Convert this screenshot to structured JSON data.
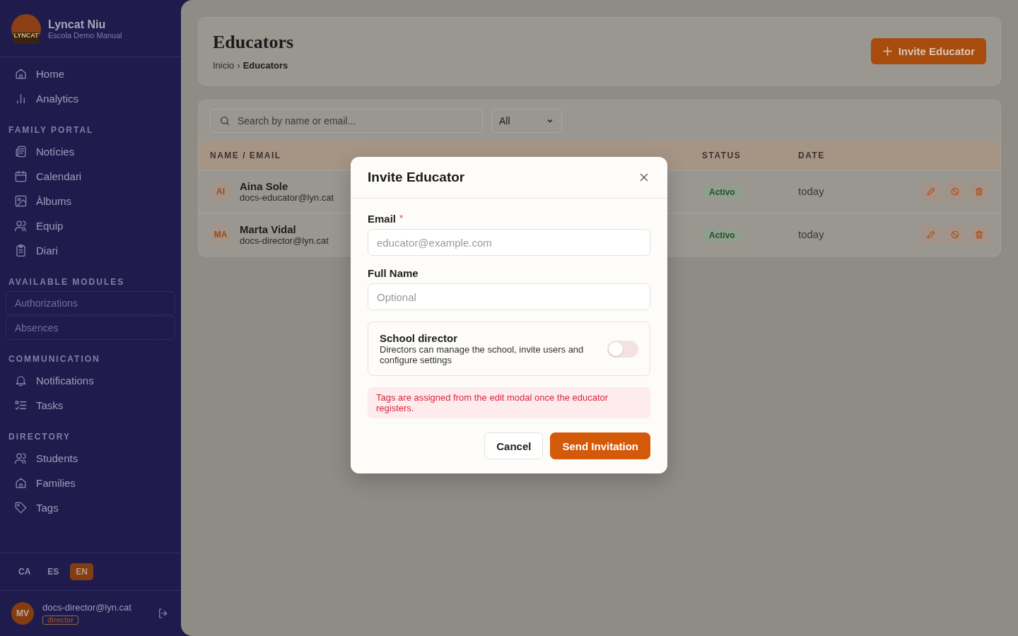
{
  "brand": {
    "name": "Lyncat Niu",
    "school": "Escola Demo Manual",
    "logo_text": "LYNCAT"
  },
  "sidebar": {
    "sections": [
      {
        "items": [
          {
            "label": "Home",
            "kind": "link"
          },
          {
            "label": "Analytics",
            "kind": "link"
          }
        ]
      },
      {
        "heading": "FAMILY PORTAL",
        "items": [
          {
            "label": "Notícies",
            "kind": "link"
          },
          {
            "label": "Calendari",
            "kind": "link"
          },
          {
            "label": "Àlbums",
            "kind": "link"
          },
          {
            "label": "Equip",
            "kind": "link"
          },
          {
            "label": "Diari",
            "kind": "link"
          }
        ]
      },
      {
        "heading": "AVAILABLE MODULES",
        "items": [
          {
            "label": "Authorizations",
            "kind": "module"
          },
          {
            "label": "Absences",
            "kind": "module"
          }
        ]
      },
      {
        "heading": "COMMUNICATION",
        "items": [
          {
            "label": "Notifications",
            "kind": "link"
          },
          {
            "label": "Tasks",
            "kind": "link"
          }
        ]
      },
      {
        "heading": "DIRECTORY",
        "items": [
          {
            "label": "Students",
            "kind": "link"
          },
          {
            "label": "Families",
            "kind": "link"
          },
          {
            "label": "Tags",
            "kind": "link"
          }
        ]
      }
    ],
    "languages": [
      {
        "label": "CA",
        "selected": false
      },
      {
        "label": "ES",
        "selected": false
      },
      {
        "label": "EN",
        "selected": true
      }
    ],
    "user": {
      "initials": "MV",
      "email": "docs-director@lyn.cat",
      "role": "director"
    }
  },
  "page": {
    "title": "Educators",
    "breadcrumb": [
      "Inicio",
      "›",
      "Educators"
    ],
    "invite_button": "Invite Educator"
  },
  "filters": {
    "search": {
      "placeholder": "Search by name or email..."
    },
    "status_select": "All"
  },
  "table": {
    "columns": [
      "NAME / EMAIL",
      "STATUS",
      "DATE"
    ],
    "rows": [
      {
        "initials": "AI",
        "name": "Aina Sole",
        "email": "docs-educator@lyn.cat",
        "status": "Activo",
        "date": "today"
      },
      {
        "initials": "MA",
        "name": "Marta Vidal",
        "email": "docs-director@lyn.cat",
        "status": "Activo",
        "date": "today"
      }
    ]
  },
  "modal": {
    "title": "Invite Educator",
    "fields": [
      {
        "label": "Email",
        "required_mark": "*",
        "placeholder": "educator@example.com"
      },
      {
        "label": "Full Name",
        "placeholder": "Optional"
      }
    ],
    "toggle": {
      "title": "School director",
      "description": "Directors can manage the school, invite users and configure settings",
      "on": false
    },
    "notice": "Tags are assigned from the edit modal once the educator registers.",
    "buttons": [
      {
        "label": "Cancel",
        "kind": "secondary"
      },
      {
        "label": "Send Invitation",
        "kind": "primary"
      }
    ]
  }
}
